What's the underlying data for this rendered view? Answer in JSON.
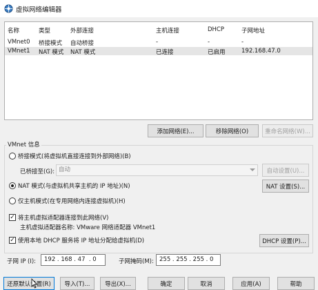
{
  "window": {
    "title": "虚拟网络编辑器"
  },
  "list": {
    "columns": [
      "名称",
      "类型",
      "外部连接",
      "主机连接",
      "DHCP",
      "子网地址"
    ],
    "rows": [
      {
        "name": "VMnet0",
        "type": "桥接模式",
        "external": "自动桥接",
        "host": "-",
        "dhcp": "-",
        "subnet": "-",
        "selected": false
      },
      {
        "name": "VMnet1",
        "type": "NAT 模式",
        "external": "NAT 模式",
        "host": "已连接",
        "dhcp": "已启用",
        "subnet": "192.168.47.0",
        "selected": true
      }
    ]
  },
  "list_buttons": {
    "add": "添加网络(E)...",
    "remove": "移除网络(O)",
    "rename": "重命名网络(W)..."
  },
  "vmnet_info": {
    "title": "VMnet 信息",
    "bridged_label": "桥接模式(将虚拟机直接连接到外部网络)(B)",
    "bridged_to_label": "已桥接至(G):",
    "bridged_to_value": "自动",
    "auto_settings": "自动设置(U)...",
    "nat_label": "NAT 模式(与虚拟机共享主机的 IP 地址)(N)",
    "nat_settings": "NAT 设置(S)...",
    "hostonly_label": "仅主机模式(在专用网络内连接虚拟机)(H)",
    "connect_adapter_label": "将主机虚拟适配器连接到此网络(V)",
    "adapter_name_label": "主机虚拟适配器名称: VMware 网络适配器 VMnet1",
    "dhcp_label": "使用本地 DHCP 服务将 IP 地址分配给虚拟机(D)",
    "dhcp_settings": "DHCP 设置(P)...",
    "selected_mode": "nat",
    "connect_adapter_checked": true,
    "dhcp_checked": true
  },
  "subnet": {
    "ip_label": "子网 IP (I):",
    "ip_value": "192 . 168 . 47  . 0",
    "mask_label": "子网掩码(M):",
    "mask_value": "255 . 255 . 255 . 0"
  },
  "footer_buttons": {
    "restore": "还原默认设置(R)",
    "import": "导入(T)...",
    "export": "导出(X)...",
    "ok": "确定",
    "cancel": "取消",
    "apply": "应用(A)",
    "help": "帮助"
  }
}
